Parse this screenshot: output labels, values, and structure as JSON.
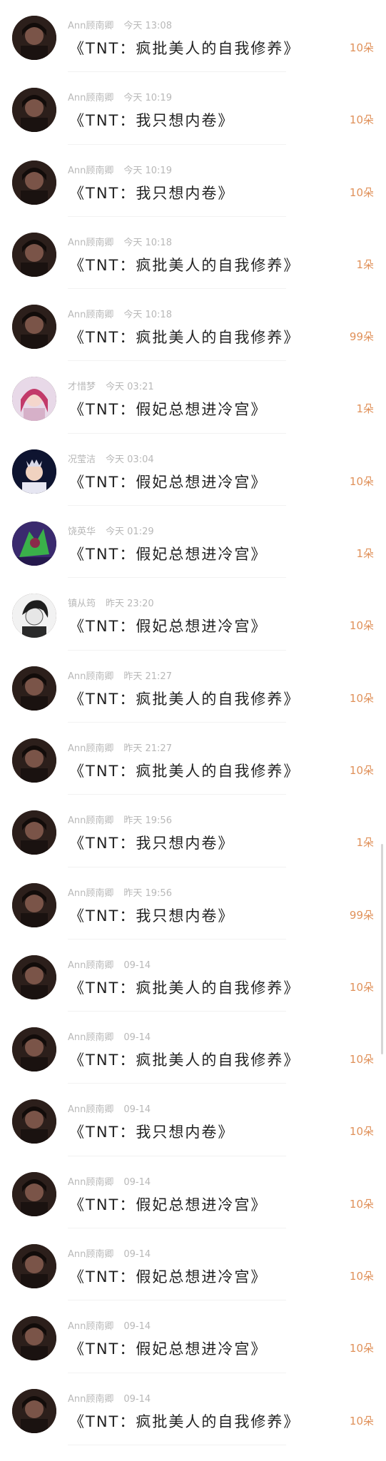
{
  "feed": {
    "items": [
      {
        "user": "Ann顾南卿",
        "time": "今天 13:08",
        "book": "《TNT：疯批美人的自我修养》",
        "amount": "10朵",
        "avatar": "avatar-dark-portrait-icon"
      },
      {
        "user": "Ann顾南卿",
        "time": "今天 10:19",
        "book": "《TNT：我只想内卷》",
        "amount": "10朵",
        "avatar": "avatar-dark-portrait-icon"
      },
      {
        "user": "Ann顾南卿",
        "time": "今天 10:19",
        "book": "《TNT：我只想内卷》",
        "amount": "10朵",
        "avatar": "avatar-dark-portrait-icon"
      },
      {
        "user": "Ann顾南卿",
        "time": "今天 10:18",
        "book": "《TNT：疯批美人的自我修养》",
        "amount": "1朵",
        "avatar": "avatar-dark-portrait-icon"
      },
      {
        "user": "Ann顾南卿",
        "time": "今天 10:18",
        "book": "《TNT：疯批美人的自我修养》",
        "amount": "99朵",
        "avatar": "avatar-dark-portrait-icon"
      },
      {
        "user": "才惜梦",
        "time": "今天 03:21",
        "book": "《TNT：假妃总想进冷宫》",
        "amount": "1朵",
        "avatar": "avatar-anime-girl-icon"
      },
      {
        "user": "况莹洁",
        "time": "今天 03:04",
        "book": "《TNT：假妃总想进冷宫》",
        "amount": "10朵",
        "avatar": "avatar-princess-icon"
      },
      {
        "user": "饶英华",
        "time": "今天 01:29",
        "book": "《TNT：假妃总想进冷宫》",
        "amount": "1朵",
        "avatar": "avatar-green-character-icon"
      },
      {
        "user": "镇从筠",
        "time": "昨天 23:20",
        "book": "《TNT：假妃总想进冷宫》",
        "amount": "10朵",
        "avatar": "avatar-sketch-boy-icon"
      },
      {
        "user": "Ann顾南卿",
        "time": "昨天 21:27",
        "book": "《TNT：疯批美人的自我修养》",
        "amount": "10朵",
        "avatar": "avatar-dark-portrait-icon"
      },
      {
        "user": "Ann顾南卿",
        "time": "昨天 21:27",
        "book": "《TNT：疯批美人的自我修养》",
        "amount": "10朵",
        "avatar": "avatar-dark-portrait-icon"
      },
      {
        "user": "Ann顾南卿",
        "time": "昨天 19:56",
        "book": "《TNT：我只想内卷》",
        "amount": "1朵",
        "avatar": "avatar-dark-portrait-icon"
      },
      {
        "user": "Ann顾南卿",
        "time": "昨天 19:56",
        "book": "《TNT：我只想内卷》",
        "amount": "99朵",
        "avatar": "avatar-dark-portrait-icon"
      },
      {
        "user": "Ann顾南卿",
        "time": "09-14",
        "book": "《TNT：疯批美人的自我修养》",
        "amount": "10朵",
        "avatar": "avatar-dark-portrait-icon"
      },
      {
        "user": "Ann顾南卿",
        "time": "09-14",
        "book": "《TNT：疯批美人的自我修养》",
        "amount": "10朵",
        "avatar": "avatar-dark-portrait-icon"
      },
      {
        "user": "Ann顾南卿",
        "time": "09-14",
        "book": "《TNT：我只想内卷》",
        "amount": "10朵",
        "avatar": "avatar-dark-portrait-icon"
      },
      {
        "user": "Ann顾南卿",
        "time": "09-14",
        "book": "《TNT：假妃总想进冷宫》",
        "amount": "10朵",
        "avatar": "avatar-dark-portrait-icon"
      },
      {
        "user": "Ann顾南卿",
        "time": "09-14",
        "book": "《TNT：假妃总想进冷宫》",
        "amount": "10朵",
        "avatar": "avatar-dark-portrait-icon"
      },
      {
        "user": "Ann顾南卿",
        "time": "09-14",
        "book": "《TNT：假妃总想进冷宫》",
        "amount": "10朵",
        "avatar": "avatar-dark-portrait-icon"
      },
      {
        "user": "Ann顾南卿",
        "time": "09-14",
        "book": "《TNT：疯批美人的自我修养》",
        "amount": "10朵",
        "avatar": "avatar-dark-portrait-icon"
      }
    ]
  },
  "colors": {
    "amount": "#e0915a",
    "meta": "#b8b8b8",
    "title": "#222222"
  }
}
